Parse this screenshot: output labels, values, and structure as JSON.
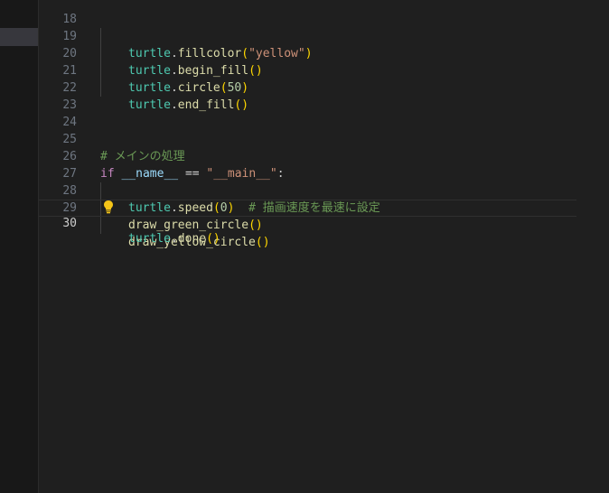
{
  "gutter": {
    "line_numbers": [
      "18",
      "19",
      "20",
      "21",
      "22",
      "23",
      "24",
      "25",
      "26",
      "27",
      "28",
      "29",
      "30"
    ]
  },
  "code": {
    "l18": {
      "obj": "turtle",
      "dot": ".",
      "fn": "fillcolor",
      "p1": "(",
      "str": "\"yellow\"",
      "p2": ")"
    },
    "l19": {
      "obj": "turtle",
      "dot": ".",
      "fn": "begin_fill",
      "parens": "()"
    },
    "l20": {
      "obj": "turtle",
      "dot": ".",
      "fn": "circle",
      "p1": "(",
      "num": "50",
      "p2": ")"
    },
    "l21": {
      "obj": "turtle",
      "dot": ".",
      "fn": "end_fill",
      "parens": "()"
    },
    "l25": {
      "comment": "# メインの処理"
    },
    "l26": {
      "kw": "if",
      "var": "__name__",
      "op": "==",
      "str": "\"__main__\"",
      "colon": ":"
    },
    "l27": {
      "obj": "turtle",
      "dot": ".",
      "fn": "speed",
      "p1": "(",
      "num": "0",
      "p2": ")",
      "comment": "# 描画速度を最速に設定"
    },
    "l28": {
      "fn": "draw_green_circle",
      "parens": "()"
    },
    "l29": {
      "fn": "draw_yellow_circle",
      "parens": "()"
    },
    "l30": {
      "obj": "turtle",
      "dot": ".",
      "fn": "done",
      "parens": "()"
    }
  },
  "icons": {
    "lightbulb": "lightbulb-icon",
    "lightbulb_color": "#f5c518"
  }
}
